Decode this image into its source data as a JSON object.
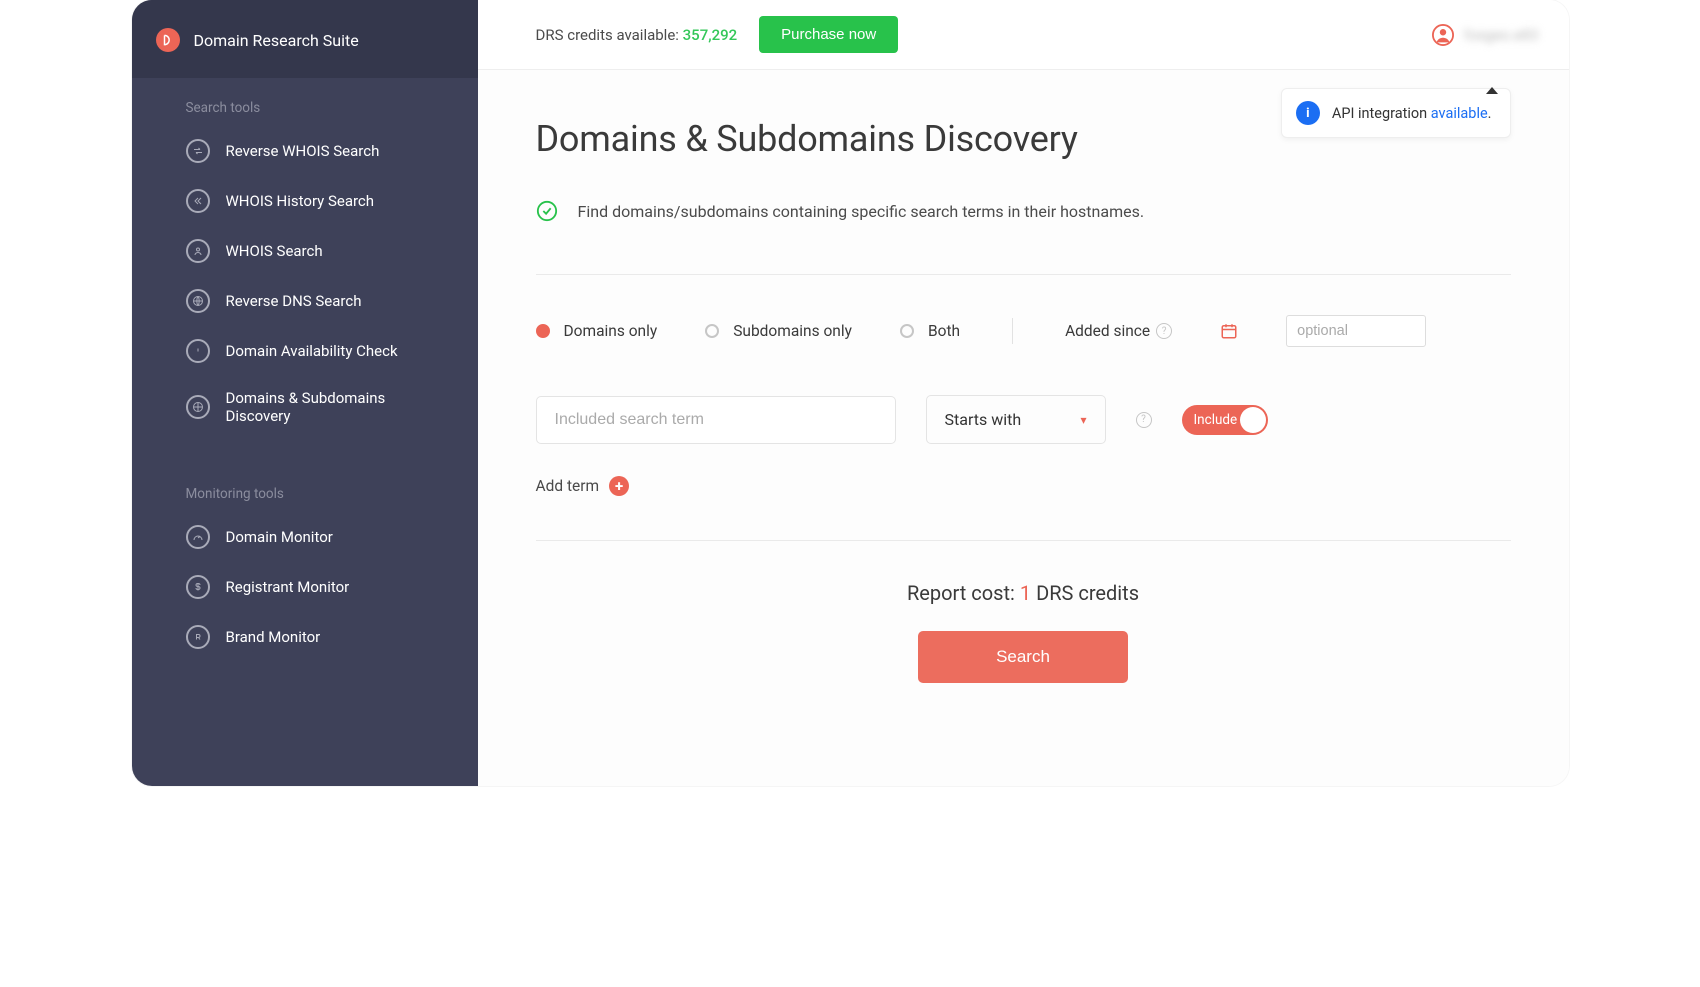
{
  "brand": "Domain Research Suite",
  "sidebar": {
    "sec1": "Search tools",
    "sec2": "Monitoring tools",
    "search_items": [
      "Reverse WHOIS Search",
      "WHOIS History Search",
      "WHOIS Search",
      "Reverse DNS Search",
      "Domain Availability Check",
      "Domains & Subdomains Discovery"
    ],
    "monitoring_items": [
      "Domain Monitor",
      "Registrant Monitor",
      "Brand Monitor"
    ]
  },
  "header": {
    "credits_label": "DRS credits available: ",
    "credits_value": "357,292",
    "purchase": "Purchase now",
    "user": "foxgeo.e83"
  },
  "api": {
    "text": "API integration ",
    "link": "available",
    "dot": "."
  },
  "page": {
    "title": "Domains & Subdomains Discovery",
    "desc": "Find domains/subdomains containing specific search terms in their hostnames."
  },
  "filters": {
    "r1": "Domains only",
    "r2": "Subdomains only",
    "r3": "Both",
    "since": "Added since",
    "date_ph": "optional"
  },
  "term": {
    "placeholder": "Included search term",
    "select_value": "Starts with",
    "toggle": "Include",
    "add": "Add term"
  },
  "cost": {
    "prefix": "Report cost: ",
    "num": "1",
    "suffix": " DRS credits"
  },
  "search": "Search"
}
